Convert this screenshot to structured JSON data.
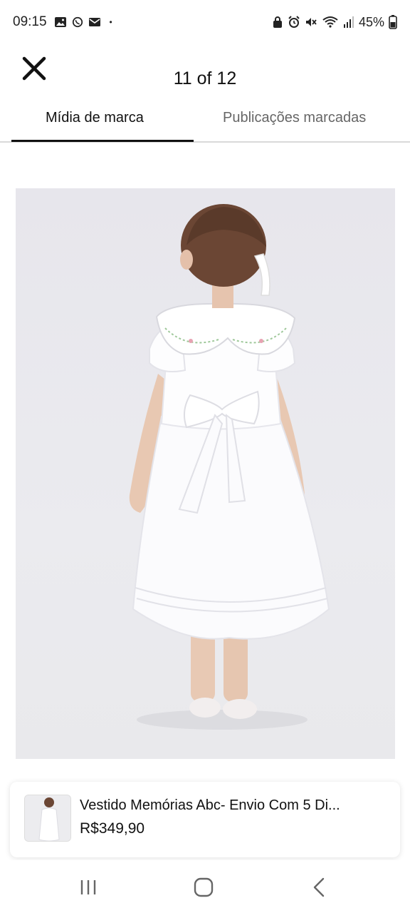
{
  "status_bar": {
    "time": "09:15",
    "battery": "45%",
    "left_icons": [
      "gallery-icon",
      "whatsapp-icon",
      "mail-icon"
    ],
    "dot": "•"
  },
  "header": {
    "counter": "11 of 12"
  },
  "tabs": [
    {
      "label": "Mídia de marca",
      "active": true
    },
    {
      "label": "Publicações marcadas",
      "active": false
    }
  ],
  "product": {
    "name": "Vestido Memórias Abc- Envio Com 5 Di...",
    "price": "R$349,90"
  },
  "colors": {
    "accent": "#111111",
    "tab_inactive": "#666666",
    "divider": "#d9d9d9",
    "photo_bg": "#e9e9ed"
  }
}
